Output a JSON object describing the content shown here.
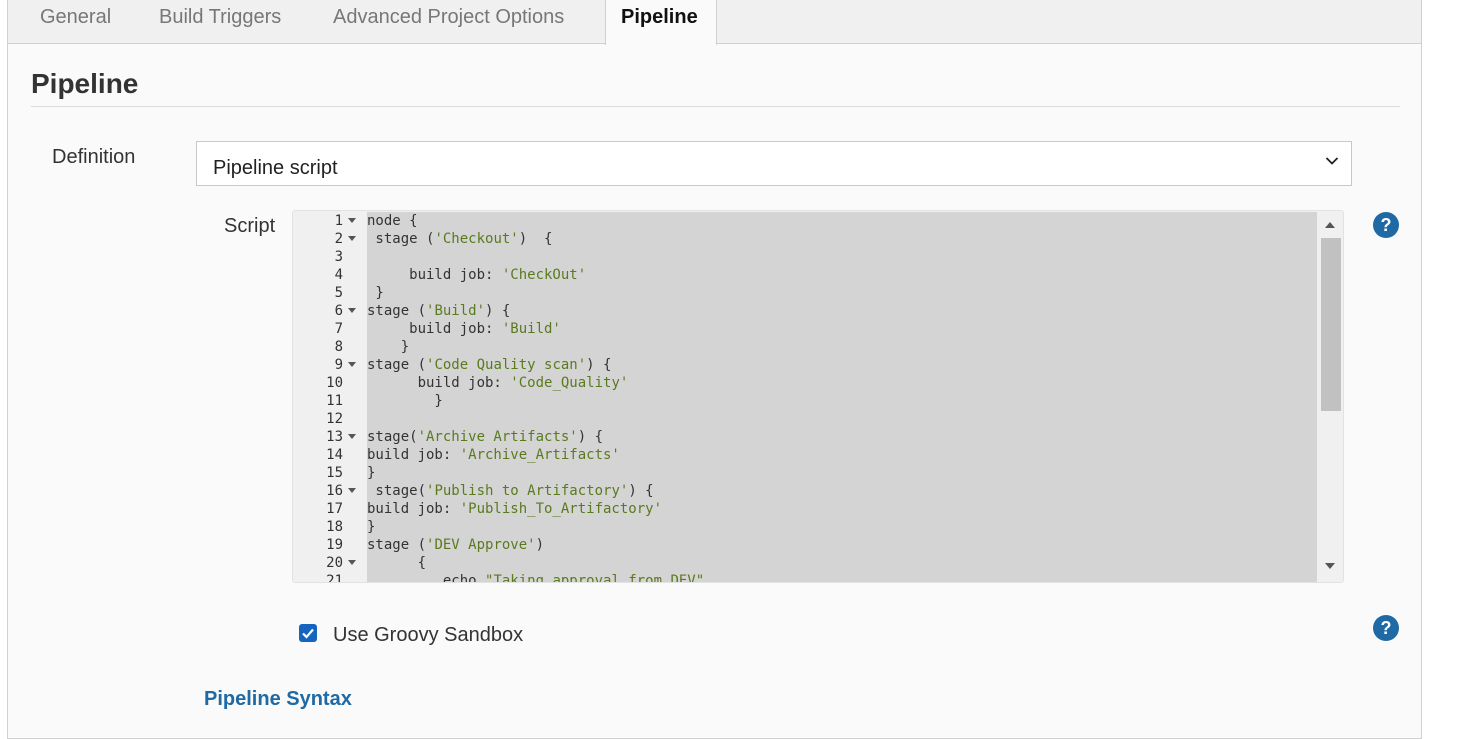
{
  "tabs": [
    {
      "label": "General",
      "active": false
    },
    {
      "label": "Build Triggers",
      "active": false
    },
    {
      "label": "Advanced Project Options",
      "active": false
    },
    {
      "label": "Pipeline",
      "active": true
    }
  ],
  "section": {
    "title": "Pipeline"
  },
  "definition": {
    "label": "Definition",
    "selected": "Pipeline script"
  },
  "script": {
    "label": "Script",
    "lines": [
      {
        "n": "1",
        "fold": true,
        "parts": [
          {
            "t": "node {",
            "s": false
          }
        ]
      },
      {
        "n": "2",
        "fold": true,
        "parts": [
          {
            "t": " stage (",
            "s": false
          },
          {
            "t": "'Checkout'",
            "s": true
          },
          {
            "t": ")  {",
            "s": false
          }
        ]
      },
      {
        "n": "3",
        "fold": false,
        "parts": [
          {
            "t": "",
            "s": false
          }
        ]
      },
      {
        "n": "4",
        "fold": false,
        "parts": [
          {
            "t": "     build job: ",
            "s": false
          },
          {
            "t": "'CheckOut'",
            "s": true
          }
        ]
      },
      {
        "n": "5",
        "fold": false,
        "parts": [
          {
            "t": " }",
            "s": false
          }
        ]
      },
      {
        "n": "6",
        "fold": true,
        "parts": [
          {
            "t": "stage (",
            "s": false
          },
          {
            "t": "'Build'",
            "s": true
          },
          {
            "t": ") {",
            "s": false
          }
        ]
      },
      {
        "n": "7",
        "fold": false,
        "parts": [
          {
            "t": "     build job: ",
            "s": false
          },
          {
            "t": "'Build'",
            "s": true
          }
        ]
      },
      {
        "n": "8",
        "fold": false,
        "parts": [
          {
            "t": "    }",
            "s": false
          }
        ]
      },
      {
        "n": "9",
        "fold": true,
        "parts": [
          {
            "t": "stage (",
            "s": false
          },
          {
            "t": "'Code Quality scan'",
            "s": true
          },
          {
            "t": ") {",
            "s": false
          }
        ]
      },
      {
        "n": "10",
        "fold": false,
        "parts": [
          {
            "t": "      build job: ",
            "s": false
          },
          {
            "t": "'Code_Quality'",
            "s": true
          }
        ]
      },
      {
        "n": "11",
        "fold": false,
        "parts": [
          {
            "t": "        }",
            "s": false
          }
        ]
      },
      {
        "n": "12",
        "fold": false,
        "parts": [
          {
            "t": "",
            "s": false
          }
        ]
      },
      {
        "n": "13",
        "fold": true,
        "parts": [
          {
            "t": "stage(",
            "s": false
          },
          {
            "t": "'Archive Artifacts'",
            "s": true
          },
          {
            "t": ") {",
            "s": false
          }
        ]
      },
      {
        "n": "14",
        "fold": false,
        "parts": [
          {
            "t": "build job: ",
            "s": false
          },
          {
            "t": "'Archive_Artifacts'",
            "s": true
          }
        ]
      },
      {
        "n": "15",
        "fold": false,
        "parts": [
          {
            "t": "}",
            "s": false
          }
        ]
      },
      {
        "n": "16",
        "fold": true,
        "parts": [
          {
            "t": " stage(",
            "s": false
          },
          {
            "t": "'Publish to Artifactory'",
            "s": true
          },
          {
            "t": ") {",
            "s": false
          }
        ]
      },
      {
        "n": "17",
        "fold": false,
        "parts": [
          {
            "t": "build job: ",
            "s": false
          },
          {
            "t": "'Publish_To_Artifactory'",
            "s": true
          }
        ]
      },
      {
        "n": "18",
        "fold": false,
        "parts": [
          {
            "t": "}",
            "s": false
          }
        ]
      },
      {
        "n": "19",
        "fold": false,
        "parts": [
          {
            "t": "stage (",
            "s": false
          },
          {
            "t": "'DEV Approve'",
            "s": true
          },
          {
            "t": ")",
            "s": false
          }
        ]
      },
      {
        "n": "20",
        "fold": true,
        "parts": [
          {
            "t": "      {",
            "s": false
          }
        ]
      },
      {
        "n": "21",
        "fold": false,
        "parts": [
          {
            "t": "         echo ",
            "s": false
          },
          {
            "t": "\"Taking approval from DEV\"",
            "s": true
          }
        ]
      }
    ]
  },
  "sandbox": {
    "label": "Use Groovy Sandbox",
    "checked": true
  },
  "syntax_link": {
    "label": "Pipeline Syntax"
  },
  "help": {
    "glyph": "?"
  },
  "colors": {
    "accent": "#1f6aa5",
    "checkbox": "#1565c0",
    "editor_bg": "#d4d4d4",
    "string": "#5a7a1e"
  }
}
